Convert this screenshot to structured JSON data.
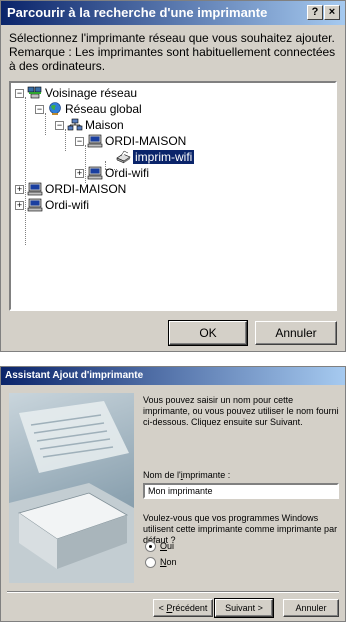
{
  "browse_dialog": {
    "title": "Parcourir à la recherche d'une imprimante",
    "help_btn": "?",
    "close_btn": "×",
    "instruction": "Sélectionnez l'imprimante réseau que vous souhaitez ajouter.",
    "remark": "Remarque : Les imprimantes sont habituellement connectées à des ordinateurs.",
    "tree": {
      "voisinage": "Voisinage réseau",
      "reseau_global": "Réseau global",
      "maison": "Maison",
      "ordi_maison_inner": "ORDI-MAISON",
      "imprim_wifi": "imprim-wifi",
      "ordi_wifi_inner": "Ordi-wifi",
      "ordi_maison": "ORDI-MAISON",
      "ordi_wifi": "Ordi-wifi"
    },
    "ok_label": "OK",
    "cancel_label": "Annuler"
  },
  "wizard": {
    "title": "Assistant Ajout d'imprimante",
    "intro": "Vous pouvez saisir un nom pour cette imprimante, ou vous pouvez utiliser le nom fourni ci-dessous. Cliquez ensuite sur Suivant.",
    "name_label_pre": "Nom de l'",
    "name_label_u": "i",
    "name_label_post": "mprimante :",
    "name_value": "Mon imprimante",
    "default_question": "Voulez-vous que vos programmes Windows utilisent cette imprimante comme imprimante par défaut ?",
    "yes_u": "O",
    "yes_rest": "ui",
    "no_u": "N",
    "no_rest": "on",
    "prev_pre": "< ",
    "prev_u": "P",
    "prev_rest": "récédent",
    "next_label": "Suivant >",
    "cancel_label": "Annuler",
    "selected_option": "Oui"
  }
}
